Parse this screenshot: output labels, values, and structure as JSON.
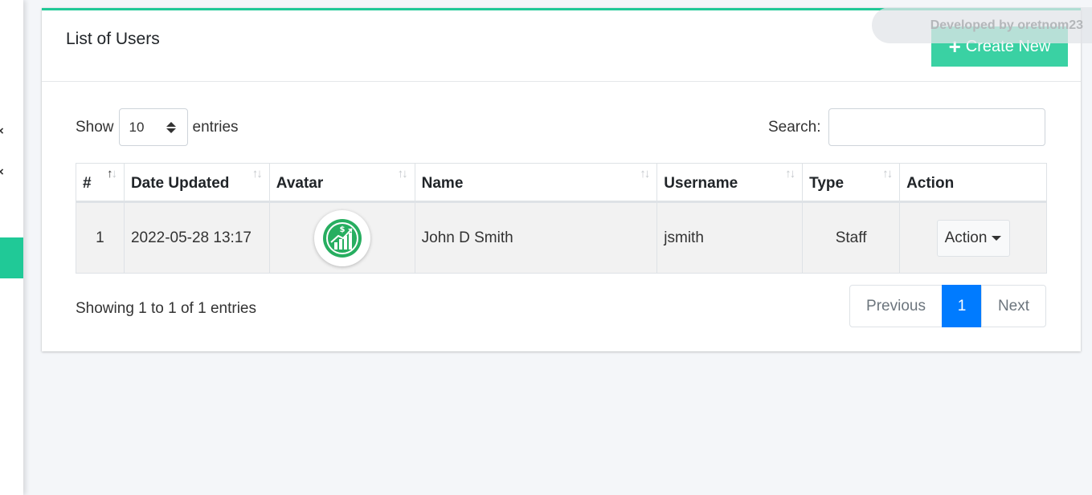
{
  "card": {
    "title": "List of Users",
    "create_label": "Create New",
    "developer_credit": "Developed by oretnom23"
  },
  "length": {
    "show_label": "Show",
    "value": "10",
    "entries_label": "entries"
  },
  "search": {
    "label": "Search:",
    "value": ""
  },
  "table": {
    "headers": [
      "#",
      "Date Updated",
      "Avatar",
      "Name",
      "Username",
      "Type",
      "Action"
    ],
    "rows": [
      {
        "index": "1",
        "date_updated": "2022-05-28 13:17",
        "name": "John D Smith",
        "username": "jsmith",
        "type": "Staff",
        "action_label": "Action"
      }
    ]
  },
  "footer": {
    "info": "Showing 1 to 1 of 1 entries",
    "previous": "Previous",
    "current_page": "1",
    "next": "Next"
  },
  "colors": {
    "accent": "#20c997",
    "primary": "#007bff"
  }
}
